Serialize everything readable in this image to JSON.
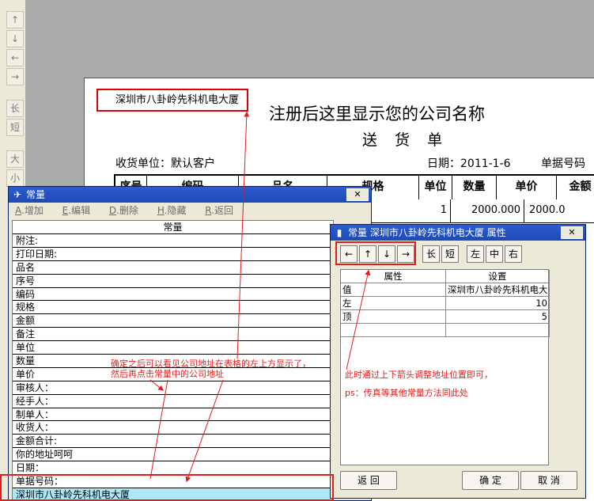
{
  "toolbar": {
    "buttons": [
      {
        "label": "↑",
        "icon": "arrow-up-icon"
      },
      {
        "label": "↓",
        "icon": "arrow-down-icon"
      },
      {
        "label": "←",
        "icon": "arrow-left-icon"
      },
      {
        "label": "→",
        "icon": "arrow-right-icon"
      },
      {
        "label": "长"
      },
      {
        "label": "短"
      },
      {
        "label": "大"
      },
      {
        "label": "小"
      }
    ]
  },
  "document": {
    "address": "深圳市八卦岭先科机电大厦",
    "company_placeholder": "注册后这里显示您的公司名称",
    "title": "送 货 单",
    "receiver_label": "收货单位：默认客户",
    "date_label": "日期：2011-1-6",
    "doc_no_label": "单据号码",
    "columns": [
      "序号",
      "编码",
      "品名",
      "规格",
      "单位",
      "数量",
      "单价",
      "金额"
    ],
    "row": {
      "qty": "1",
      "price": "2000.000",
      "amount": "2000.0"
    }
  },
  "constants_window": {
    "title": "常量",
    "menu": [
      {
        "key": "A",
        "label": ".增加"
      },
      {
        "key": "E",
        "label": ".编辑"
      },
      {
        "key": "D",
        "label": ".删除"
      },
      {
        "key": "H",
        "label": ".隐藏"
      },
      {
        "key": "R",
        "label": ".返回"
      }
    ],
    "column_header": "常量",
    "items": [
      "附注:",
      "打印日期:",
      "品名",
      "序号",
      "编码",
      "规格",
      "金额",
      "备注",
      "单位",
      "数量",
      "单价",
      "审核人：",
      "经手人：",
      "制单人：",
      "收货人：",
      "金额合计:",
      "你的地址呵呵",
      "日期：",
      "单据号码：",
      "深圳市八卦岭先科机电大厦"
    ],
    "selected_index": 19
  },
  "property_window": {
    "title": "常量 深圳市八卦岭先科机电大厦 属性",
    "toolbar": [
      "←",
      "↑",
      "↓",
      "→",
      "长",
      "短",
      "左",
      "中",
      "右"
    ],
    "headers": [
      "属性",
      "设置"
    ],
    "rows": [
      {
        "name": "值",
        "value": "深圳市八卦岭先科机电大"
      },
      {
        "name": "左",
        "value": "10"
      },
      {
        "name": "顶",
        "value": "5"
      }
    ],
    "footer": {
      "back": "返 回",
      "ok": "确 定",
      "cancel": "取 消"
    }
  },
  "annotations": {
    "left_note_1": "确定之后可以看见公司地址在表格的左上方显示了，",
    "left_note_2": "然后再点击常量中的公司地址",
    "right_note_1": "此时通过上下箭头调整地址位置即可，",
    "right_note_2": "ps：传真等其他常量方法同此处"
  },
  "colors": {
    "annotation": "#e21d1d",
    "titlebar": "#1c4ab5",
    "selection": "#aee8f6"
  }
}
